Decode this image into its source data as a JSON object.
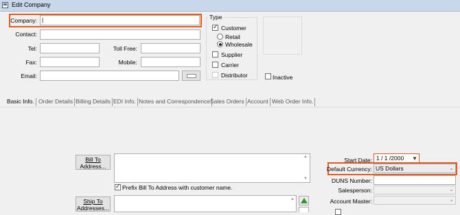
{
  "window": {
    "title": "Edit Company"
  },
  "labels": {
    "company": "Company:",
    "contact": "Contact:",
    "tel": "Tel:",
    "toll_free": "Toll Free:",
    "fax": "Fax:",
    "mobile": "Mobile:",
    "email": "Email:"
  },
  "fields": {
    "company": "|",
    "contact": "",
    "tel": "",
    "toll_free": "",
    "fax": "",
    "mobile": "",
    "email": ""
  },
  "type_group": {
    "title": "Type",
    "customer": {
      "label": "Customer",
      "checked": true
    },
    "retail": {
      "label": "Retail",
      "selected": false
    },
    "wholesale": {
      "label": "Wholesale",
      "selected": true
    },
    "supplier": {
      "label": "Supplier",
      "checked": false
    },
    "carrier": {
      "label": "Carrier",
      "checked": false
    },
    "distributor": {
      "label": "Distributor",
      "checked": false
    }
  },
  "inactive": {
    "label": "Inactive",
    "checked": false
  },
  "tabs": [
    {
      "label": "Basic Info.",
      "active": true
    },
    {
      "label": "Order Details",
      "active": false
    },
    {
      "label": "Billing Details",
      "active": false
    },
    {
      "label": "EDI Info.",
      "active": false
    },
    {
      "label": "Notes and Correspondence",
      "active": false
    },
    {
      "label": "Sales Orders",
      "active": false
    },
    {
      "label": "Account",
      "active": false
    },
    {
      "label": "Web Order Info.",
      "active": false
    }
  ],
  "bill_to": {
    "button_line1": "Bill To",
    "button_line2": "Address...",
    "value": ""
  },
  "prefix_checkbox": {
    "label": "Prefix Bill To Address with customer name.",
    "checked": true
  },
  "ship_to": {
    "button_line1": "Ship To",
    "button_line2": "Addresses...",
    "value": ""
  },
  "right_panel": {
    "start_date_label": "Start Date:",
    "start_date_value": "1 / 1 /2000",
    "default_currency_label": "Default Currency:",
    "default_currency_value": "US Dollars",
    "duns_label": "DUNS Number:",
    "duns_value": "",
    "salesperson_label": "Salesperson:",
    "salesperson_value": "",
    "account_master_label": "Account Master:",
    "account_master_value": ""
  },
  "colors": {
    "highlight": "#e4591a",
    "titlebar": "#c9d7ea",
    "add_arrow": "#2e9a2e"
  }
}
